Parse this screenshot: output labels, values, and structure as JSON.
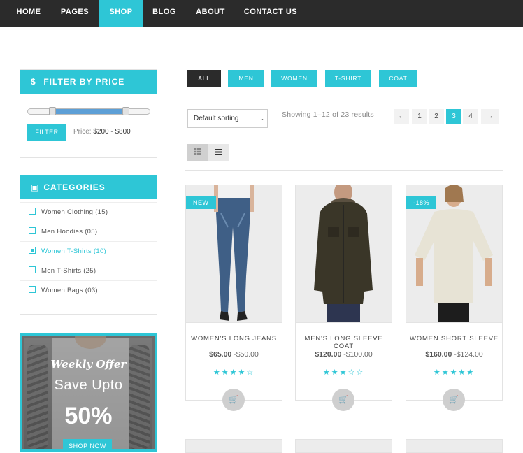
{
  "nav": {
    "items": [
      {
        "label": "HOME"
      },
      {
        "label": "PAGES"
      },
      {
        "label": "SHOP"
      },
      {
        "label": "BLOG"
      },
      {
        "label": "ABOUT"
      },
      {
        "label": "CONTACT US"
      }
    ],
    "active": "SHOP"
  },
  "price_filter": {
    "title": "FILTER BY PRICE",
    "icon": "dollar-icon",
    "button": "FILTER",
    "price_label": "Price:",
    "price_range": "$200 - $800",
    "range_min_fraction": 0.2,
    "range_max_fraction": 0.8
  },
  "categories": {
    "title": "CATEGORIES",
    "icon": "bag-icon",
    "items": [
      {
        "label": "Women Clothing (15)",
        "checked": false
      },
      {
        "label": "Men Hoodies (05)",
        "checked": false
      },
      {
        "label": "Women T-Shirts (10)",
        "checked": true
      },
      {
        "label": "Men T-Shirts (25)",
        "checked": false
      },
      {
        "label": "Women Bags (03)",
        "checked": false
      }
    ]
  },
  "promo": {
    "weekly": "Weekly Offer",
    "save": "Save Upto",
    "percent": "50%",
    "button": "SHOP NOW"
  },
  "filter_tabs": [
    {
      "label": "ALL",
      "active": true
    },
    {
      "label": "MEN",
      "active": false
    },
    {
      "label": "WOMEN",
      "active": false
    },
    {
      "label": "T-SHIRT",
      "active": false
    },
    {
      "label": "COAT",
      "active": false
    }
  ],
  "toolbar": {
    "sort_value": "Default sorting",
    "showing": "Showing 1–12 of 23 results",
    "pagination": [
      "←",
      "1",
      "2",
      "3",
      "4",
      "→"
    ],
    "current_page": "3",
    "view_grid_icon": "grid-icon",
    "view_list_icon": "list-icon"
  },
  "products": [
    {
      "name": "WOMEN'S LONG JEANS",
      "old_price": "$65.00",
      "new_price": "-$50.00",
      "badge": "NEW",
      "rating": 4,
      "image": "jeans-model"
    },
    {
      "name": "MEN'S LONG SLEEVE COAT",
      "old_price": "$120.00",
      "new_price": "-$100.00",
      "badge": "",
      "rating": 3,
      "image": "jacket-model"
    },
    {
      "name": "WOMEN SHORT SLEEVE",
      "old_price": "$160.00",
      "new_price": "-$124.00",
      "badge": "-18%",
      "rating": 5,
      "image": "top-model"
    }
  ],
  "colors": {
    "accent": "#2ec6d6",
    "nav_bg": "#2b2b2b",
    "slider": "#5d9fd6"
  }
}
